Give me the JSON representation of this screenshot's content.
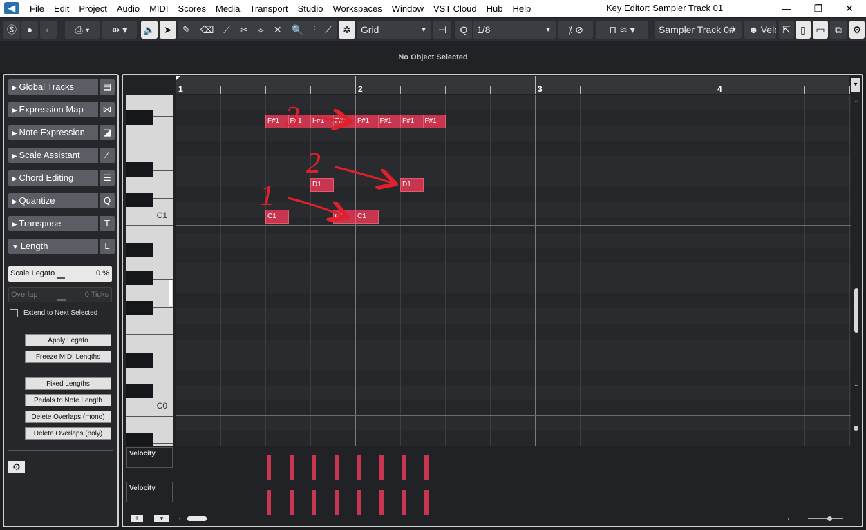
{
  "menu": {
    "items": [
      "File",
      "Edit",
      "Project",
      "Audio",
      "MIDI",
      "Scores",
      "Media",
      "Transport",
      "Studio",
      "Workspaces",
      "Window",
      "VST Cloud",
      "Hub",
      "Help"
    ],
    "window_title": "Key Editor: Sampler Track 01",
    "window_buttons": [
      "—",
      "❐",
      "✕"
    ]
  },
  "toolbar": {
    "snap_type": "Grid",
    "quantize": "1/8",
    "track": "Sampler Track 0#",
    "velocity_tab": "Velo"
  },
  "infoline": {
    "text": "No Object Selected"
  },
  "inspector": {
    "sections": [
      {
        "label": "Global Tracks",
        "icon": "▤",
        "expanded": false
      },
      {
        "label": "Expression Map",
        "icon": "⋈",
        "expanded": false
      },
      {
        "label": "Note Expression",
        "icon": "◪",
        "expanded": false
      },
      {
        "label": "Scale Assistant",
        "icon": "⁄",
        "expanded": false
      },
      {
        "label": "Chord Editing",
        "icon": "☰",
        "expanded": false
      },
      {
        "label": "Quantize",
        "icon": "Q",
        "expanded": false
      },
      {
        "label": "Transpose",
        "icon": "T",
        "expanded": false
      },
      {
        "label": "Length",
        "icon": "L",
        "expanded": true
      }
    ],
    "scale_legato": {
      "label": "Scale Legato",
      "value": "0 %"
    },
    "overlap": {
      "label": "Overlap",
      "value": "0 Ticks"
    },
    "extend_label": "Extend to Next Selected",
    "buttons_group1": [
      "Apply Legato",
      "Freeze MIDI Lengths"
    ],
    "buttons_group2": [
      "Fixed Lengths",
      "Pedals to Note Length",
      "Delete Overlaps (mono)",
      "Delete Overlaps (poly)"
    ]
  },
  "ruler": {
    "bars": [
      "1",
      "2",
      "3",
      "4"
    ]
  },
  "keyboard": {
    "labels": [
      "C1",
      "C0"
    ]
  },
  "notes": [
    {
      "name": "F#1",
      "beat": 4,
      "row": 0
    },
    {
      "name": "F#1",
      "beat": 5,
      "row": 0
    },
    {
      "name": "F#1",
      "beat": 6,
      "row": 0
    },
    {
      "name": "F#1",
      "beat": 7,
      "row": 0
    },
    {
      "name": "F#1",
      "beat": 8,
      "row": 0
    },
    {
      "name": "F#1",
      "beat": 9,
      "row": 0
    },
    {
      "name": "F#1",
      "beat": 10,
      "row": 0
    },
    {
      "name": "F#1",
      "beat": 11,
      "row": 0
    },
    {
      "name": "D1",
      "beat": 6,
      "row": 1
    },
    {
      "name": "D1",
      "beat": 10,
      "row": 1
    },
    {
      "name": "C1",
      "beat": 4,
      "row": 2
    },
    {
      "name": "C1",
      "beat": 7,
      "row": 2
    },
    {
      "name": "C1",
      "beat": 8,
      "row": 2
    }
  ],
  "velocity_lanes": [
    "Velocity",
    "Velocity"
  ],
  "annotations": [
    "3",
    "2",
    "1"
  ],
  "colors": {
    "note": "#c8354e",
    "accent_border": "#d0d0d0"
  }
}
